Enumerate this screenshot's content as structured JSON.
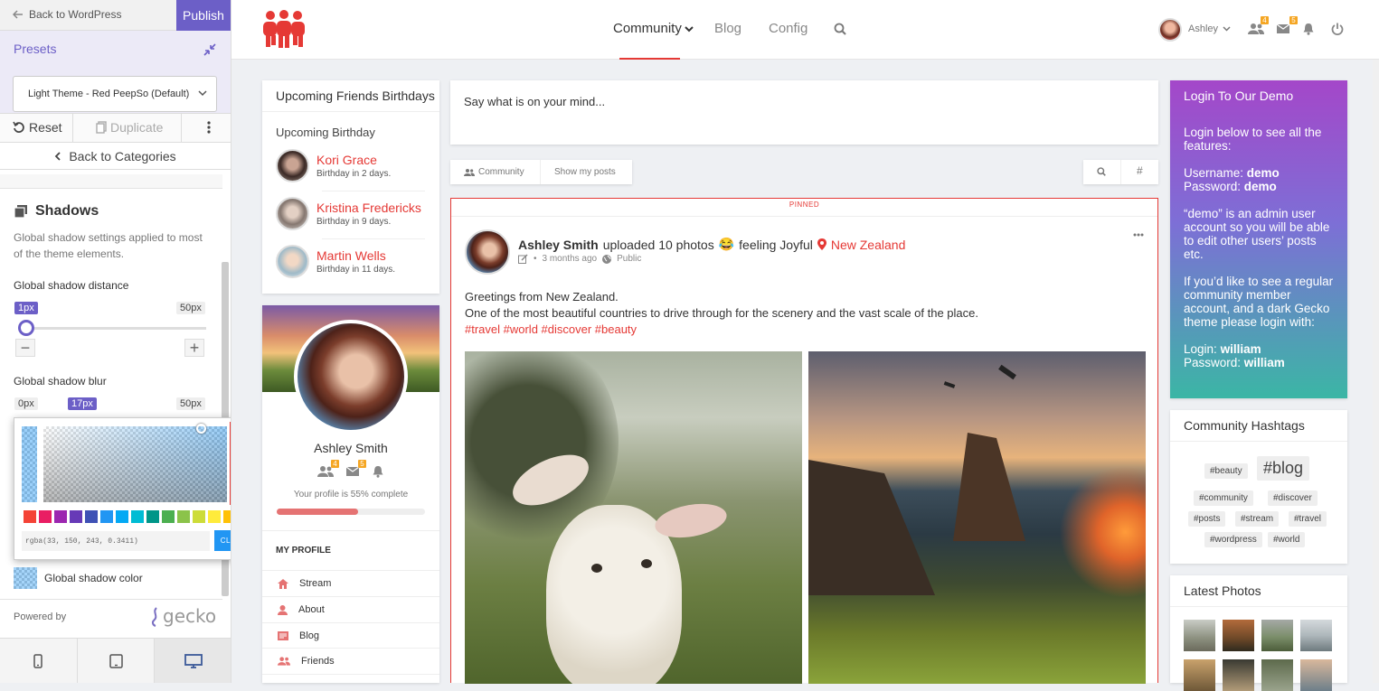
{
  "customizer": {
    "back_label": "Back to WordPress",
    "publish_label": "Publish",
    "presets_title": "Presets",
    "preset_selected": "Light Theme - Red PeepSo (Default)",
    "reset_label": "Reset",
    "duplicate_label": "Duplicate",
    "back_categories": "Back to Categories",
    "section_title": "Shadows",
    "section_desc": "Global shadow settings applied to most of the theme elements.",
    "distance_label": "Global shadow distance",
    "distance_value": "1px",
    "distance_max": "50px",
    "blur_label": "Global shadow blur",
    "blur_min": "0px",
    "blur_value": "17px",
    "blur_max": "50px",
    "color_value": "rgba(33, 150, 243, 0.3411)",
    "close_label": "CLOSE",
    "color_label": "Global shadow color",
    "powered_by": "Powered by",
    "gecko_logo": "gecko",
    "swatches": [
      "#f44336",
      "#e91e63",
      "#9c27b0",
      "#673ab7",
      "#3f51b5",
      "#2196f3",
      "#03a9f4",
      "#00bcd4",
      "#009688",
      "#4caf50",
      "#8bc34a",
      "#cddc39",
      "#ffeb3b",
      "#ffc107"
    ]
  },
  "header": {
    "nav": [
      "Community",
      "Blog",
      "Config"
    ],
    "user": "Ashley",
    "friend_requests": "4",
    "messages": "5"
  },
  "birthdays": {
    "title": "Upcoming Friends Birthdays",
    "subtitle": "Upcoming Birthday",
    "items": [
      {
        "name": "Kori Grace",
        "when": "Birthday in 2 days."
      },
      {
        "name": "Kristina Fredericks",
        "when": "Birthday in 9 days."
      },
      {
        "name": "Martin Wells",
        "when": "Birthday in 11 days."
      }
    ]
  },
  "profile": {
    "name": "Ashley Smith",
    "friend_requests": "4",
    "messages": "5",
    "complete_text": "Your profile is 55% complete",
    "complete_pct": 55,
    "menu_title": "MY PROFILE",
    "menu": [
      "Stream",
      "About",
      "Blog",
      "Friends"
    ]
  },
  "composer": {
    "placeholder": "Say what is on your mind..."
  },
  "filters": {
    "community": "Community",
    "show_my_posts": "Show my posts"
  },
  "post": {
    "pinned": "PINNED",
    "author": "Ashley Smith",
    "action": "uploaded 10 photos",
    "emoji": "😂",
    "feeling": "feeling Joyful",
    "location": "New Zealand",
    "time": "3 months ago",
    "privacy": "Public",
    "line1": "Greetings from New Zealand.",
    "line2": "One of the most beautiful countries to drive through for the scenery and the vast scale of the place.",
    "tags": "#travel #world #discover #beauty"
  },
  "demo": {
    "title": "Login To Our Demo",
    "intro": "Login below to see all the features:",
    "user_label": "Username:",
    "user_value": "demo",
    "pass_label": "Password:",
    "pass_value": "demo",
    "admin_note": "“demo” is an admin user account so you will be able to edit other users’ posts etc.",
    "regular_note": "If you’d like to see a regular community member account, and a dark Gecko theme please login with:",
    "login_label": "Login:",
    "login_value": "william",
    "pass2_label": "Password:",
    "pass2_value": "william"
  },
  "hashtags": {
    "title": "Community Hashtags",
    "tags": [
      "#beauty",
      "#blog",
      "#community",
      "#discover",
      "#posts",
      "#stream",
      "#travel",
      "#wordpress",
      "#world"
    ]
  },
  "photos": {
    "title": "Latest Photos"
  }
}
